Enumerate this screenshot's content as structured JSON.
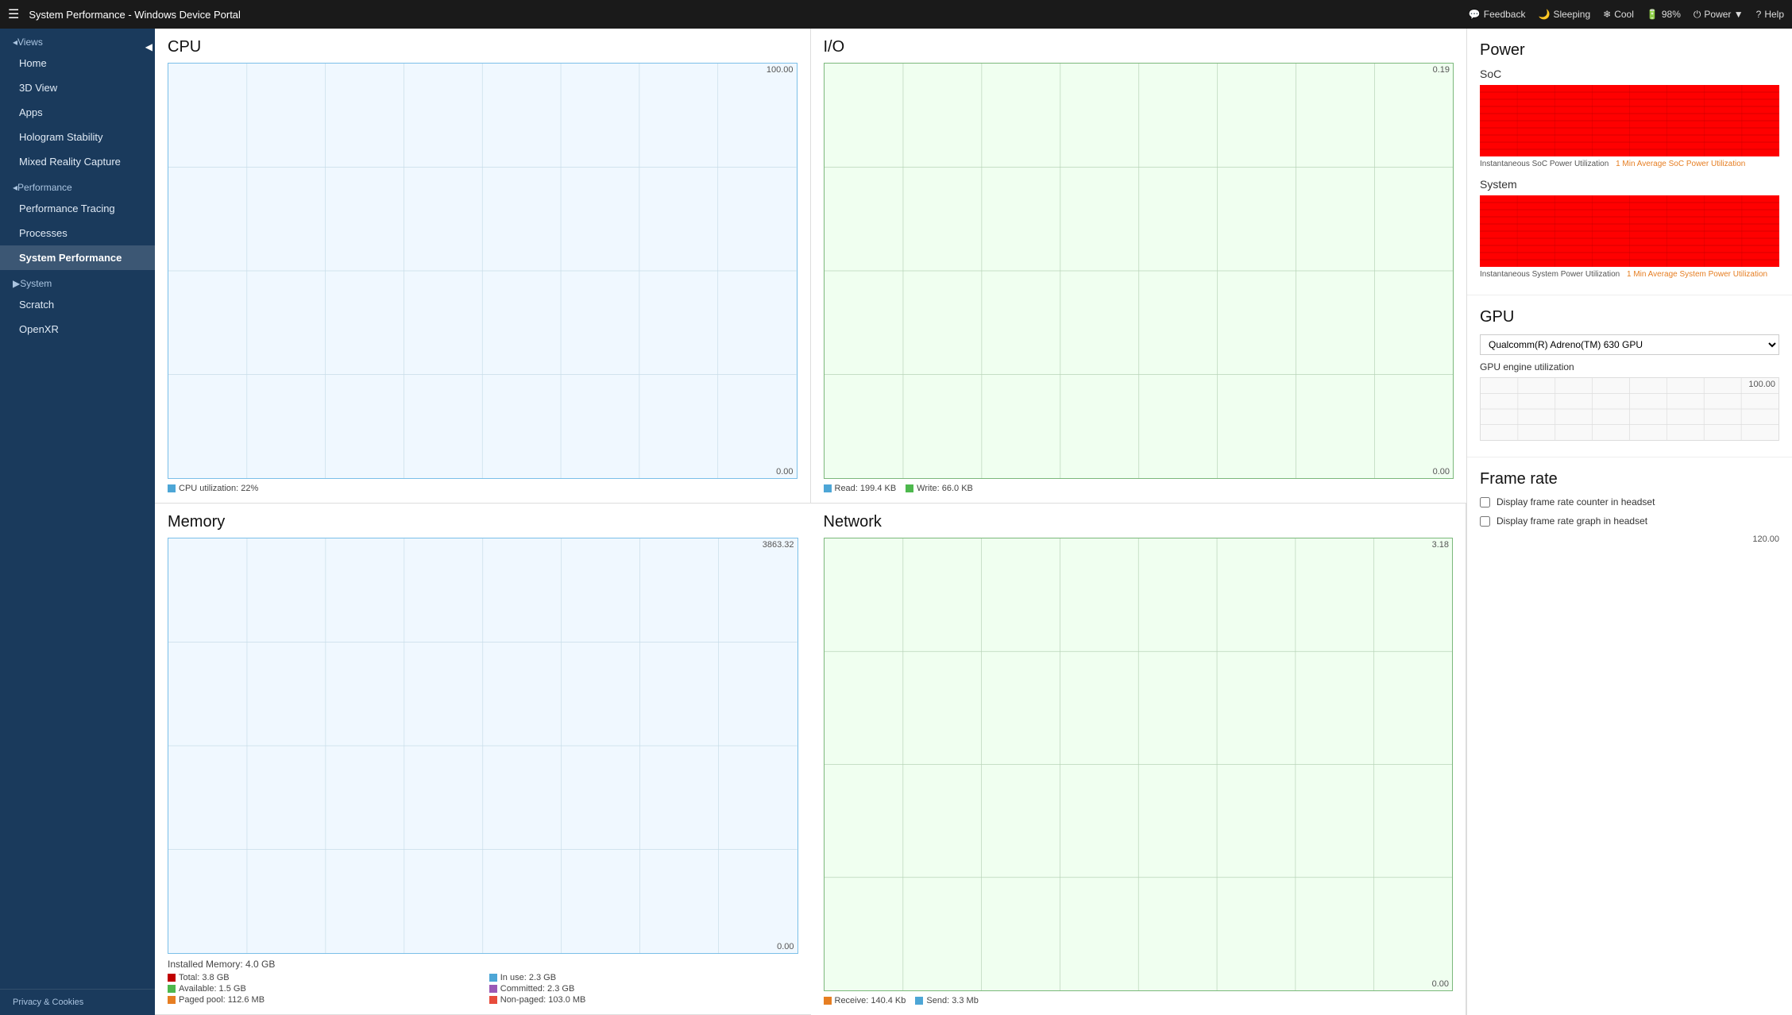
{
  "titlebar": {
    "title": "System Performance - Windows Device Portal",
    "menu_icon": "☰",
    "actions": [
      {
        "id": "feedback",
        "icon": "💬",
        "label": "Feedback"
      },
      {
        "id": "sleeping",
        "icon": "🌙",
        "label": "Sleeping"
      },
      {
        "id": "cool",
        "icon": "❄",
        "label": "Cool"
      },
      {
        "id": "battery",
        "icon": "🔋",
        "label": "98%"
      },
      {
        "id": "power",
        "icon": "⏻",
        "label": "Power ▼"
      },
      {
        "id": "help",
        "icon": "?",
        "label": "Help"
      }
    ]
  },
  "sidebar": {
    "collapse_icon": "◀",
    "views_header": "◂Views",
    "items_views": [
      {
        "id": "home",
        "label": "Home",
        "active": false
      },
      {
        "id": "3dview",
        "label": "3D View",
        "active": false
      },
      {
        "id": "apps",
        "label": "Apps",
        "active": false
      },
      {
        "id": "hologram",
        "label": "Hologram Stability",
        "active": false
      },
      {
        "id": "mixed-reality",
        "label": "Mixed Reality Capture",
        "active": false
      }
    ],
    "performance_header": "◂Performance",
    "items_performance": [
      {
        "id": "perf-tracing",
        "label": "Performance Tracing",
        "active": false
      },
      {
        "id": "processes",
        "label": "Processes",
        "active": false
      },
      {
        "id": "system-perf",
        "label": "System Performance",
        "active": true
      }
    ],
    "system_header": "▶System",
    "items_system": [
      {
        "id": "scratch",
        "label": "Scratch",
        "active": false
      },
      {
        "id": "openxr",
        "label": "OpenXR",
        "active": false
      }
    ],
    "footer": "Privacy & Cookies"
  },
  "cpu": {
    "title": "CPU",
    "max_label": "100.00",
    "min_label": "0.00",
    "legend_color": "#4da6d6",
    "legend_text": "CPU utilization: 22%"
  },
  "io": {
    "title": "I/O",
    "max_label": "0.19",
    "min_label": "0.00",
    "legend_read_color": "#4da6d6",
    "legend_write_color": "#4db84d",
    "legend_read": "Read: 199.4 KB",
    "legend_write": "Write: 66.0 KB"
  },
  "memory": {
    "title": "Memory",
    "max_label": "3863.32",
    "min_label": "0.00",
    "installed": "Installed Memory: 4.0 GB",
    "legend": [
      {
        "color": "#c00000",
        "label": "Total: 3.8 GB"
      },
      {
        "color": "#4da6d6",
        "label": "In use: 2.3 GB"
      },
      {
        "color": "#4db84d",
        "label": "Available: 1.5 GB"
      },
      {
        "color": "#9b59b6",
        "label": "Committed: 2.3 GB"
      },
      {
        "color": "#e67e22",
        "label": "Paged pool: 112.6 MB"
      },
      {
        "color": "#e74c3c",
        "label": "Non-paged: 103.0 MB"
      }
    ]
  },
  "network": {
    "title": "Network",
    "max_label": "3.18",
    "min_label": "0.00",
    "legend_receive_color": "#e67e22",
    "legend_send_color": "#4da6d6",
    "legend_receive": "Receive: 140.4 Kb",
    "legend_send": "Send: 3.3 Mb"
  },
  "power": {
    "title": "Power",
    "soc_title": "SoC",
    "system_title": "System",
    "legend_instant": "Instantaneous SoC Power Utilization",
    "legend_avg": "1 Min Average SoC Power Utilization",
    "legend_avg_color": "#e67e22",
    "legend_sys_instant": "Instantaneous System Power Utilization",
    "legend_sys_avg": "1 Min Average System Power Utilization",
    "legend_sys_avg_color": "#e67e22"
  },
  "gpu": {
    "title": "GPU",
    "label": "GPU engine utilization",
    "select_label": "Qualcomm(R) Adreno(TM) 630 GPU",
    "select_options": [
      "Qualcomm(R) Adreno(TM) 630 GPU"
    ],
    "max_label": "100.00"
  },
  "framerate": {
    "title": "Frame rate",
    "option1": "Display frame rate counter in headset",
    "option2": "Display frame rate graph in headset",
    "max_label": "120.00"
  }
}
